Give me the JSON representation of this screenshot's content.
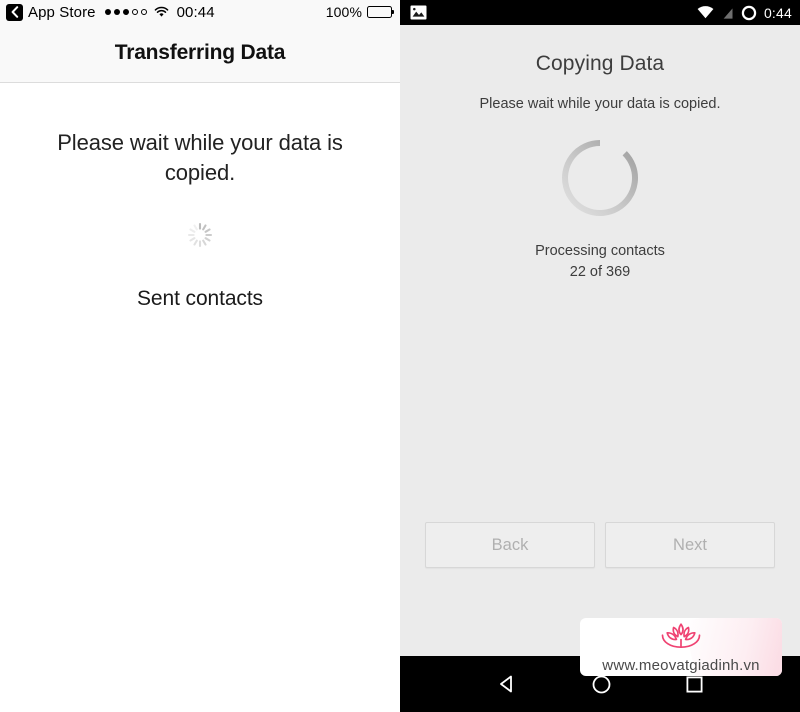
{
  "ios": {
    "status_bar": {
      "back_label": "App Store",
      "back_icon": "chevron-left-icon",
      "signal_dots_filled": 3,
      "signal_dots_empty": 2,
      "wifi_icon": "wifi-icon",
      "time": "00:44",
      "battery_percent": "100%",
      "battery_icon": "battery-full-icon"
    },
    "nav_bar": {
      "title": "Transferring Data"
    },
    "content": {
      "message": "Please wait while your data is copied.",
      "spinner_icon": "activity-indicator-spinner",
      "status_text": "Sent contacts"
    }
  },
  "android": {
    "status_bar": {
      "image_icon": "photo-icon",
      "wifi_icon": "wifi-icon",
      "signal_icon": "signal-off-icon",
      "battery_icon": "battery-ring-icon",
      "time": "0:44"
    },
    "content": {
      "title": "Copying Data",
      "subtitle": "Please wait while your data is copied.",
      "spinner_icon": "circular-progress-spinner",
      "progress_label": "Processing contacts",
      "progress_count": "22 of 369"
    },
    "buttons": {
      "back_label": "Back",
      "next_label": "Next"
    },
    "nav_bar": {
      "back_icon": "triangle-back-icon",
      "home_icon": "circle-home-icon",
      "recents_icon": "square-recents-icon"
    }
  },
  "watermark": {
    "logo_icon": "lotus-flower-logo",
    "url": "www.meovatgiadinh.vn",
    "accent_color": "#ef4372"
  }
}
